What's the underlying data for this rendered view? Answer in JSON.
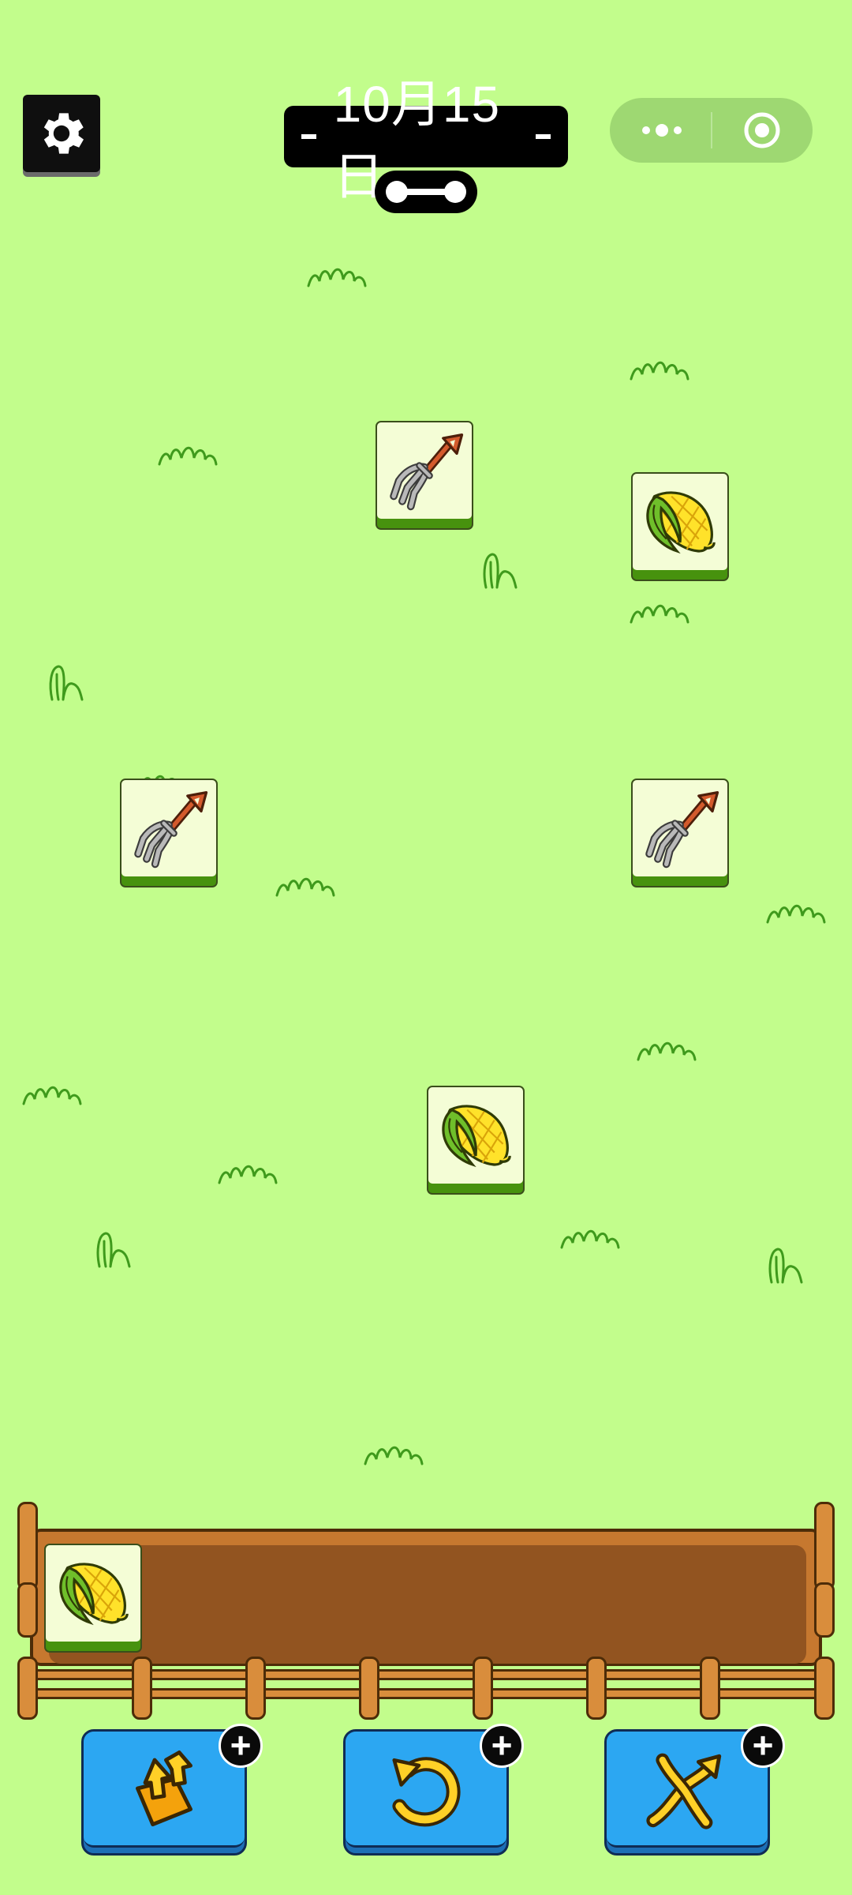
{
  "header": {
    "date_label": "10月15日",
    "settings_icon": "gear-icon",
    "capsule_menu_icon": "more-dots-icon",
    "capsule_close_icon": "target-circle-icon"
  },
  "board": {
    "tiles": [
      {
        "item": "pitchfork"
      },
      {
        "item": "corn"
      },
      {
        "item": "pitchfork"
      },
      {
        "item": "pitchfork"
      },
      {
        "item": "corn"
      }
    ]
  },
  "tray": {
    "slots_filled": 1,
    "items": [
      {
        "item": "corn"
      }
    ]
  },
  "tools": [
    {
      "name": "remove-tiles",
      "icon": "lift-out-icon",
      "badge": "+"
    },
    {
      "name": "undo",
      "icon": "undo-icon",
      "badge": "+"
    },
    {
      "name": "shuffle",
      "icon": "shuffle-icon",
      "badge": "+"
    }
  ],
  "colors": {
    "background": "#c2fd8c",
    "tile_face": "#f4fdd6",
    "tile_base": "#47920e",
    "tray_wood": "#c6782f",
    "tool_button": "#2ca7f2"
  }
}
